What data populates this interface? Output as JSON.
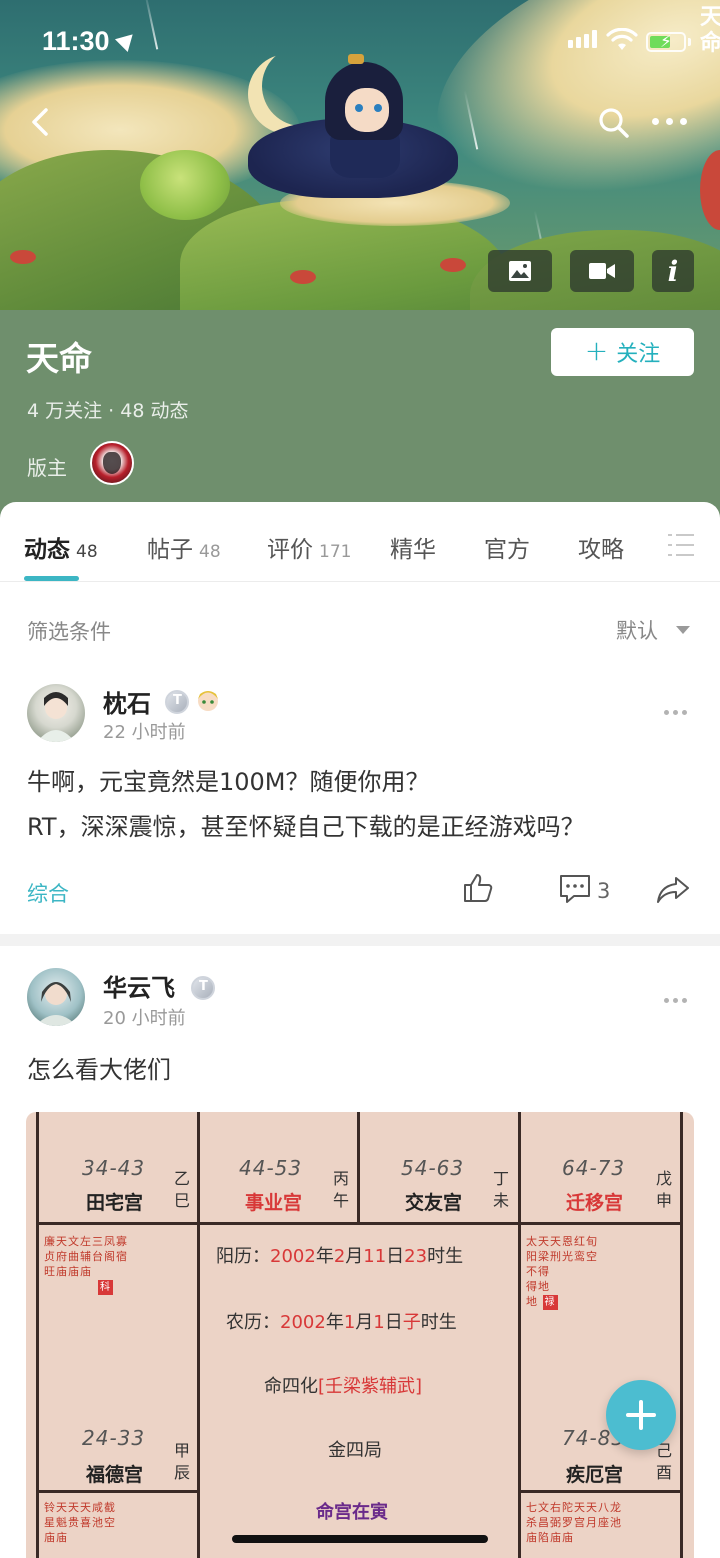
{
  "status_bar": {
    "time": "11:30"
  },
  "banner": {
    "logo_text": "天命"
  },
  "header": {
    "title": "天命",
    "stats": "4 万关注 · 48 动态",
    "moderator_label": "版主",
    "follow_label": "关注",
    "colors": {
      "header_bg": "#6f8f6d",
      "accent": "#3cb6c4"
    }
  },
  "tabs": [
    {
      "label": "动态",
      "count": "48"
    },
    {
      "label": "帖子",
      "count": "48"
    },
    {
      "label": "评价",
      "count": "171"
    },
    {
      "label": "精华",
      "count": ""
    },
    {
      "label": "官方",
      "count": ""
    },
    {
      "label": "攻略",
      "count": ""
    }
  ],
  "filter": {
    "label": "筛选条件",
    "sort": "默认"
  },
  "posts": [
    {
      "author": "枕石",
      "time": "22 小时前",
      "body_line1": "牛啊，元宝竟然是100M？随便你用？",
      "body_line2": "RT，深深震惊，甚至怀疑自己下载的是正经游戏吗？",
      "category": "综合",
      "comment_count": "3"
    },
    {
      "author": "华云飞",
      "time": "20 小时前",
      "body_line1": "怎么看大佬们"
    }
  ],
  "astro_chart": {
    "top_palaces": [
      {
        "age": "34-43",
        "name": "田宅宫",
        "stem": "乙巳"
      },
      {
        "age": "44-53",
        "name": "事业宫",
        "stem": "丙午"
      },
      {
        "age": "54-63",
        "name": "交友宫",
        "stem": "丁未"
      },
      {
        "age": "64-73",
        "name": "迁移宫",
        "stem": "戊申"
      }
    ],
    "left_stars": [
      "廉天文左三凤寡",
      "贞府曲辅台阁宿",
      "旺庙庙庙"
    ],
    "left_tag": "科",
    "right_stars": [
      "太天天恩红旬",
      "阳梁刑光鸾空",
      "不得",
      "得地",
      "地"
    ],
    "right_tag": "禄",
    "middle_left": {
      "age": "24-33",
      "name": "福德宫",
      "stem": "甲辰"
    },
    "middle_right": {
      "age": "74-83",
      "name": "疾厄宫",
      "stem": "己酉"
    },
    "center": {
      "solar_prefix": "阳历：",
      "solar_year": "2002",
      "solar_y": "年",
      "solar_month": "2",
      "solar_m": "月",
      "solar_day": "11",
      "solar_d": "日",
      "solar_hour": "23",
      "solar_suffix": "时生",
      "lunar_prefix": "农历：",
      "lunar_year": "2002",
      "lunar_y": "年",
      "lunar_month": "1",
      "lunar_m": "月",
      "lunar_day": "1",
      "lunar_d": "日",
      "lunar_hour": "子",
      "lunar_suffix": "时生",
      "sihua_prefix": "命四化",
      "sihua": "[壬梁紫辅武]",
      "ju": "金四局",
      "ming": "命宫在寅"
    },
    "bottom_left_stars": [
      "铃天天天咸截",
      "星魁贵喜池空",
      "庙庙"
    ],
    "bottom_right_stars": [
      "七文右陀天天八龙",
      "杀昌弼罗宫月座池",
      "庙陷庙庙"
    ]
  }
}
